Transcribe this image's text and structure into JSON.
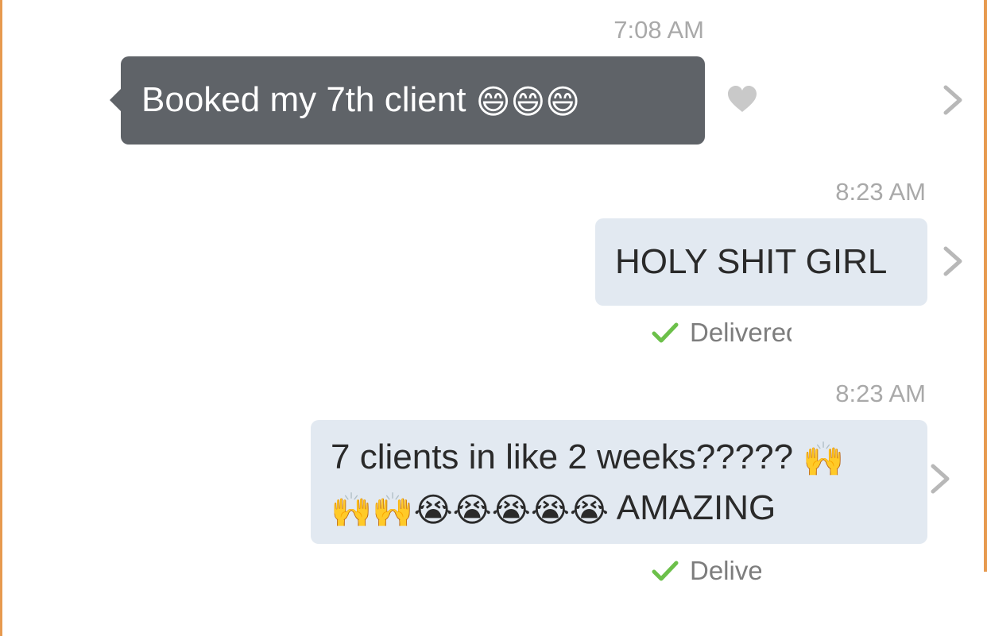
{
  "messages": [
    {
      "time": "7:08 AM",
      "direction": "incoming",
      "text": "Booked my 7th client",
      "emoji": "😄😄😄"
    },
    {
      "time": "8:23 AM",
      "direction": "outgoing",
      "text": "HOLY SHIT GIRL",
      "status": "Delivered"
    },
    {
      "time": "8:23 AM",
      "direction": "outgoing",
      "line1_text": "7 clients in like 2 weeks?????",
      "line1_emoji": "🙌",
      "line2_emoji": "🙌🙌😭😭😭😭😭",
      "line2_text": "AMAZING",
      "status": "Delivered"
    }
  ],
  "icons": {
    "like": "heart-icon",
    "details": "chevron-right-icon",
    "delivered": "checkmark-icon"
  },
  "colors": {
    "incoming_bubble": "#5f6368",
    "outgoing_bubble": "#e2e9f1",
    "timestamp": "#a9a9a9",
    "delivered_check": "#6cc04a",
    "accent_edge": "#e79a4f"
  }
}
